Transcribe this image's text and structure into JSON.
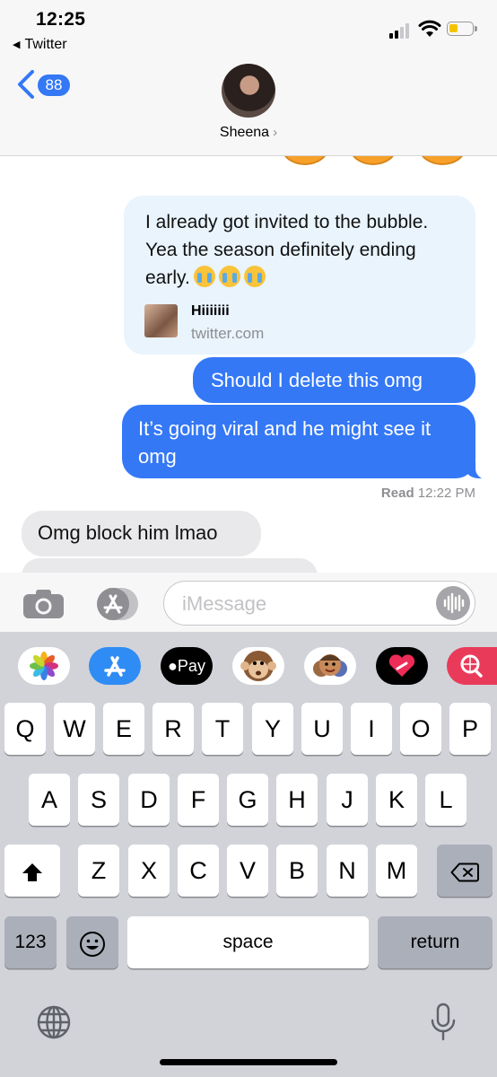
{
  "status_bar": {
    "time": "12:25",
    "back_app": "Twitter"
  },
  "header": {
    "back_badge": "88",
    "contact_name": "Sheena"
  },
  "messages": {
    "link_preview": {
      "text": "I already got invited to the bubble. Yea the season definitely ending early.",
      "title": "Hiiiiiii",
      "domain": "twitter.com"
    },
    "sent": [
      "Should I delete this omg",
      "It’s going viral and he might see it omg"
    ],
    "receipt_label": "Read",
    "receipt_time": "12:22 PM",
    "received": [
      "Omg block him lmao"
    ]
  },
  "compose": {
    "placeholder": "iMessage"
  },
  "app_drawer": {
    "items": [
      "photos-app",
      "app-store-app",
      "apple-pay-app",
      "animoji-app",
      "memoji-app",
      "digital-touch-app",
      "images-search-app"
    ],
    "apple_pay_label": "Pay"
  },
  "keyboard": {
    "row1": [
      "Q",
      "W",
      "E",
      "R",
      "T",
      "Y",
      "U",
      "I",
      "O",
      "P"
    ],
    "row2": [
      "A",
      "S",
      "D",
      "F",
      "G",
      "H",
      "J",
      "K",
      "L"
    ],
    "row3": [
      "Z",
      "X",
      "C",
      "V",
      "B",
      "N",
      "M"
    ],
    "numbers_label": "123",
    "space_label": "space",
    "return_label": "return"
  },
  "colors": {
    "accent": "#3478f6",
    "received_bubble": "#e9e9eb",
    "link_bubble": "#e9f4fd",
    "keyboard_bg": "#d1d3d9"
  }
}
